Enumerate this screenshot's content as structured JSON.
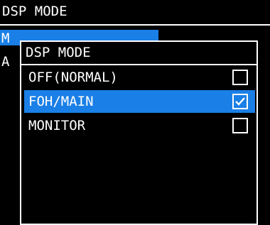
{
  "screen": {
    "title": "DSP MODE",
    "background_rows": [
      {
        "char": "M",
        "selected": true
      },
      {
        "char": "A",
        "selected": false
      }
    ]
  },
  "dialog": {
    "title": "DSP MODE",
    "options": [
      {
        "label": "OFF(NORMAL)",
        "checked": false,
        "selected": false
      },
      {
        "label": "FOH/MAIN",
        "checked": true,
        "selected": true
      },
      {
        "label": "MONITOR",
        "checked": false,
        "selected": false
      }
    ]
  },
  "colors": {
    "background": "#000000",
    "foreground": "#ffffff",
    "selection": "#1a7fe6"
  },
  "icons": {
    "checked": "checkmark-icon"
  }
}
